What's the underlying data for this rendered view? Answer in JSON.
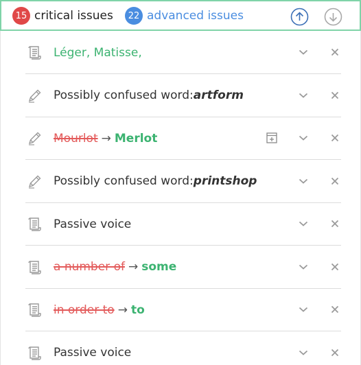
{
  "header": {
    "critical": {
      "count": "15",
      "label": "critical issues",
      "color": "#e04848"
    },
    "advanced": {
      "count": "22",
      "label": "advanced issues",
      "color": "#4a8de0",
      "label_color": "#4a8de0"
    },
    "prev_icon": "arrow-up-circle-icon",
    "next_icon": "arrow-down-circle-icon",
    "border_color": "#7fd3a8"
  },
  "issues": [
    {
      "icon": "document-icon",
      "parts": [
        {
          "text": "Léger, Matisse,",
          "style": "green"
        }
      ]
    },
    {
      "icon": "pencil-icon",
      "parts": [
        {
          "text": "Possibly confused word: ",
          "style": "plain"
        },
        {
          "text": "artform",
          "style": "bolditalic"
        }
      ]
    },
    {
      "icon": "pencil-icon",
      "has_dictionary": true,
      "parts": [
        {
          "text": "Mourlot",
          "style": "strike"
        },
        {
          "text": "→",
          "style": "arrow"
        },
        {
          "text": "Merlot",
          "style": "green-bold"
        }
      ]
    },
    {
      "icon": "pencil-icon",
      "parts": [
        {
          "text": "Possibly confused word: ",
          "style": "plain"
        },
        {
          "text": "printshop",
          "style": "bolditalic"
        }
      ]
    },
    {
      "icon": "document-icon",
      "parts": [
        {
          "text": "Passive voice",
          "style": "plain"
        }
      ]
    },
    {
      "icon": "document-icon",
      "parts": [
        {
          "text": "a number of",
          "style": "strike"
        },
        {
          "text": "→",
          "style": "arrow"
        },
        {
          "text": "some",
          "style": "green-bold"
        }
      ]
    },
    {
      "icon": "document-icon",
      "parts": [
        {
          "text": "in order to",
          "style": "strike"
        },
        {
          "text": "→",
          "style": "arrow"
        },
        {
          "text": "to",
          "style": "green-bold"
        }
      ]
    },
    {
      "icon": "document-icon",
      "parts": [
        {
          "text": "Passive voice",
          "style": "plain"
        }
      ]
    }
  ]
}
